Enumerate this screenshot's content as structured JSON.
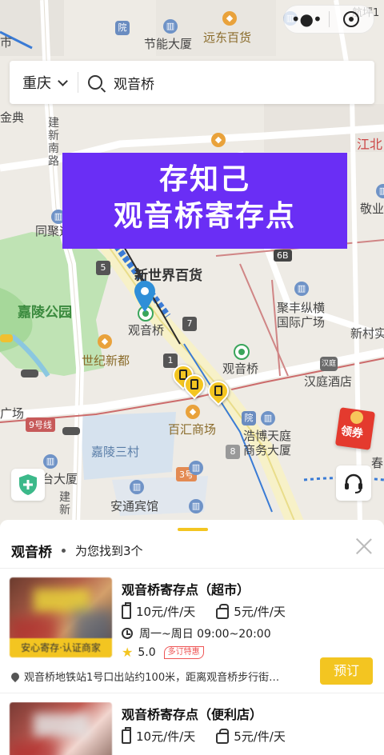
{
  "map": {
    "labels": {
      "jieneng": "节能大厦",
      "yuandong": "远东百货",
      "jinbei": "建新南路",
      "tongju": "同聚远",
      "shi": "市",
      "jindian": "金典",
      "jiangbei": "江北",
      "jingye": "敬业",
      "xinshijie": "新世界百货",
      "jialing_park": "嘉陵公园",
      "guanyinqiao_station": "观音桥",
      "guanyinqiao_station2": "观音桥",
      "shiji": "世纪新都",
      "jufeng": "聚丰纵横\n国际广场",
      "hanting": "汉庭酒店",
      "xincun": "新村实",
      "baihui": "百汇商场",
      "haobo": "浩博天庭\n商务大厦",
      "jialing_sancun": "嘉陵三村",
      "taida": "台大厦",
      "anxin": "安通宾馆",
      "guangchang": "广场",
      "chun": "春",
      "jianxin_vert": "建新",
      "line9": "9号线",
      "hangbei": "航坪1",
      "road_6b": "6B",
      "road_5": "5",
      "road_7": "7",
      "road_1": "1",
      "road_8": "8",
      "road_3": "3号"
    }
  },
  "capsule": {
    "more_icon": "more-dots-icon",
    "close_icon": "target-icon"
  },
  "search": {
    "city": "重庆",
    "value": "观音桥"
  },
  "banner": {
    "line1": "存知己",
    "line2": "观音桥寄存点"
  },
  "coupon": {
    "label": "领券"
  },
  "sheet": {
    "keyword": "观音桥",
    "found_text": "为您找到3个",
    "results": [
      {
        "title": "观音桥寄存点（超市）",
        "price_luggage": "10元/件/天",
        "price_bag": "5元/件/天",
        "hours": "周一~周日 09:00~20:00",
        "rating": "5.0",
        "promo": "多订特惠",
        "tag": "安心寄存·认证商家",
        "address": "观音桥地铁站1号口出站约100米，距离观音桥步行街…",
        "book_label": "预订"
      },
      {
        "title": "观音桥寄存点（便利店）",
        "price_luggage": "10元/件/天",
        "price_bag": "5元/件/天"
      }
    ]
  },
  "colors": {
    "accent": "#f3c521",
    "banner": "#6a2ef5",
    "metro": "#3aa55b"
  }
}
